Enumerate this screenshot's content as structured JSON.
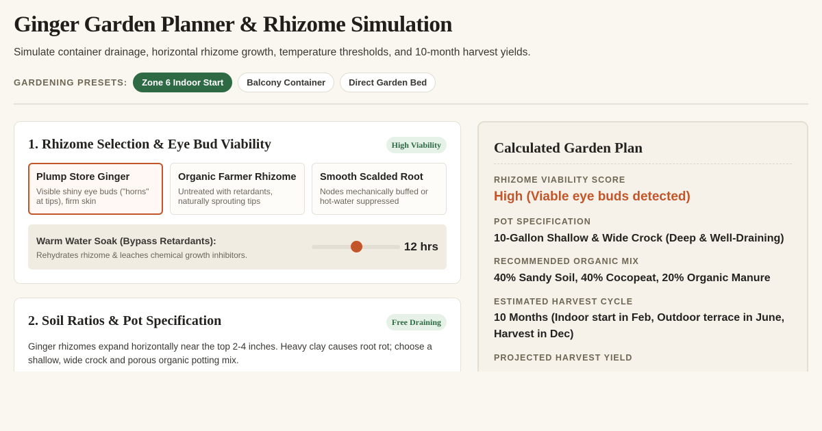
{
  "header": {
    "title": "Ginger Garden Planner & Rhizome Simulation",
    "subtitle": "Simulate container drainage, horizontal rhizome growth, temperature thresholds, and 10-month harvest yields."
  },
  "presets": {
    "label": "GARDENING PRESETS:",
    "options": [
      {
        "label": "Zone 6 Indoor Start",
        "active": true
      },
      {
        "label": "Balcony Container",
        "active": false
      },
      {
        "label": "Direct Garden Bed",
        "active": false
      }
    ]
  },
  "rhizome_section": {
    "heading": "1. Rhizome Selection & Eye Bud Viability",
    "badge": "High Viability",
    "options": [
      {
        "title": "Plump Store Ginger",
        "description": "Visible shiny eye buds (\"horns\" at tips), firm skin",
        "selected": true
      },
      {
        "title": "Organic Farmer Rhizome",
        "description": "Untreated with retardants, naturally sprouting tips",
        "selected": false
      },
      {
        "title": "Smooth Scalded Root",
        "description": "Nodes mechanically buffed or hot-water suppressed",
        "selected": false
      }
    ],
    "soak": {
      "title": "Warm Water Soak (Bypass Retardants):",
      "description": "Rehydrates rhizome & leaches chemical growth inhibitors.",
      "value_label": "12 hrs",
      "slider_fraction": 0.5
    }
  },
  "soil_section": {
    "heading": "2. Soil Ratios & Pot Specification",
    "badge": "Free Draining",
    "body": "Ginger rhizomes expand horizontally near the top 2-4 inches. Heavy clay causes root rot; choose a shallow, wide crock and porous organic potting mix."
  },
  "plan": {
    "title": "Calculated Garden Plan",
    "items": [
      {
        "label": "RHIZOME VIABILITY SCORE",
        "value": "High (Viable eye buds detected)",
        "accent": true
      },
      {
        "label": "POT SPECIFICATION",
        "value": "10-Gallon Shallow & Wide Crock (Deep & Well-Draining)",
        "accent": false
      },
      {
        "label": "RECOMMENDED ORGANIC MIX",
        "value": "40% Sandy Soil, 40% Cocopeat, 20% Organic Manure",
        "accent": false
      },
      {
        "label": "ESTIMATED HARVEST CYCLE",
        "value": "10 Months (Indoor start in Feb, Outdoor terrace in June, Harvest in Dec)",
        "accent": false
      },
      {
        "label": "PROJECTED HARVEST YIELD",
        "value": "",
        "accent": true
      }
    ]
  },
  "colors": {
    "accent_green": "#2e6b45",
    "accent_rust": "#c2562a",
    "background": "#faf7f1"
  }
}
